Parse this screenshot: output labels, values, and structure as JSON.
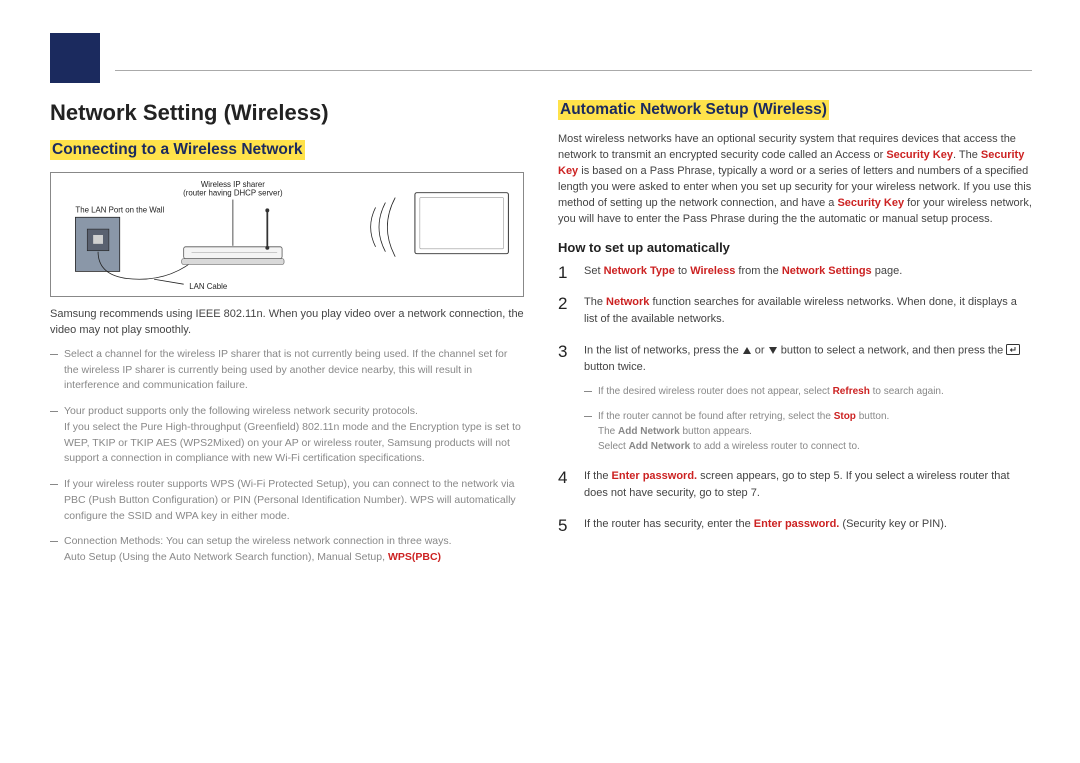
{
  "left": {
    "title": "Network Setting (Wireless)",
    "subhead": "Connecting to a Wireless Network",
    "diagram": {
      "label_sharer1": "Wireless IP sharer",
      "label_sharer2": "(router having DHCP server)",
      "label_lanport": "The LAN Port on the Wall",
      "label_lancable": "LAN Cable"
    },
    "intro": "Samsung recommends using IEEE 802.11n. When you play video over a network connection, the video may not play smoothly.",
    "bullets": [
      "Select a channel for the wireless IP sharer that is not currently being used. If the channel set for the wireless IP sharer is currently being used by another device nearby, this will result in interference and communication failure.",
      "Your product supports only the following wireless network security protocols.\nIf you select the Pure High-throughput (Greenfield) 802.11n mode and the Encryption type is set to WEP, TKIP or TKIP AES (WPS2Mixed) on your AP or wireless router, Samsung products will not support a connection in compliance with new Wi-Fi certification specifications.",
      "If your wireless router supports WPS (Wi-Fi Protected Setup), you can connect to the network via PBC (Push Button Configuration) or PIN (Personal Identification Number). WPS will automatically configure the SSID and WPA key in either mode."
    ],
    "bullet4_pre": "Connection Methods: You can setup the wireless network connection in three ways.\nAuto Setup (Using the Auto Network Search function), Manual Setup, ",
    "bullet4_term": "WPS(PBC)"
  },
  "right": {
    "subhead": "Automatic Network Setup (Wireless)",
    "intro_pre1": "Most wireless networks have an optional security system that requires devices that access the network to transmit an encrypted security code called an Access or ",
    "intro_t1": "Security Key",
    "intro_mid1": ". The ",
    "intro_t2": "Security Key",
    "intro_mid2": " is based on a Pass Phrase, typically a word or a series of letters and numbers of a specified length you were asked to enter when you set up security for your wireless network. If you use this method of setting up the network connection, and have a ",
    "intro_t3": "Security Key",
    "intro_post": " for your wireless network, you will have to enter the Pass Phrase during the the automatic or manual setup process.",
    "howto_heading": "How to set up automatically",
    "steps": {
      "s1_pre": "Set ",
      "s1_t1": "Network Type",
      "s1_mid1": " to ",
      "s1_t2": "Wireless",
      "s1_mid2": " from the ",
      "s1_t3": "Network Settings",
      "s1_post": " page.",
      "s2_pre": "The ",
      "s2_t1": "Network",
      "s2_post": " function searches for available wireless networks. When done, it displays a list of the available networks.",
      "s3_pre": "In the list of networks, press the ",
      "s3_mid": " or ",
      "s3_mid2": " button to select a network, and then press the ",
      "s3_post": " button twice.",
      "s3_sub1_pre": "If the desired wireless router does not appear, select ",
      "s3_sub1_term": "Refresh",
      "s3_sub1_post": " to search again.",
      "s3_sub2_pre": "If the router cannot be found after retrying, select the ",
      "s3_sub2_term": "Stop",
      "s3_sub2_post": " button.",
      "s3_sub2_l2_pre": "The ",
      "s3_sub2_l2_term": "Add Network",
      "s3_sub2_l2_post": " button appears.",
      "s3_sub2_l3_pre": "Select ",
      "s3_sub2_l3_term": "Add Network",
      "s3_sub2_l3_post": " to add a wireless router to connect to.",
      "s4_pre": "If the ",
      "s4_term": "Enter password.",
      "s4_post": " screen appears, go to step 5. If you select a wireless router that does not have security, go to step 7.",
      "s5_pre": "If the router has security, enter the ",
      "s5_term": "Enter password.",
      "s5_post": " (Security key or PIN)."
    }
  }
}
